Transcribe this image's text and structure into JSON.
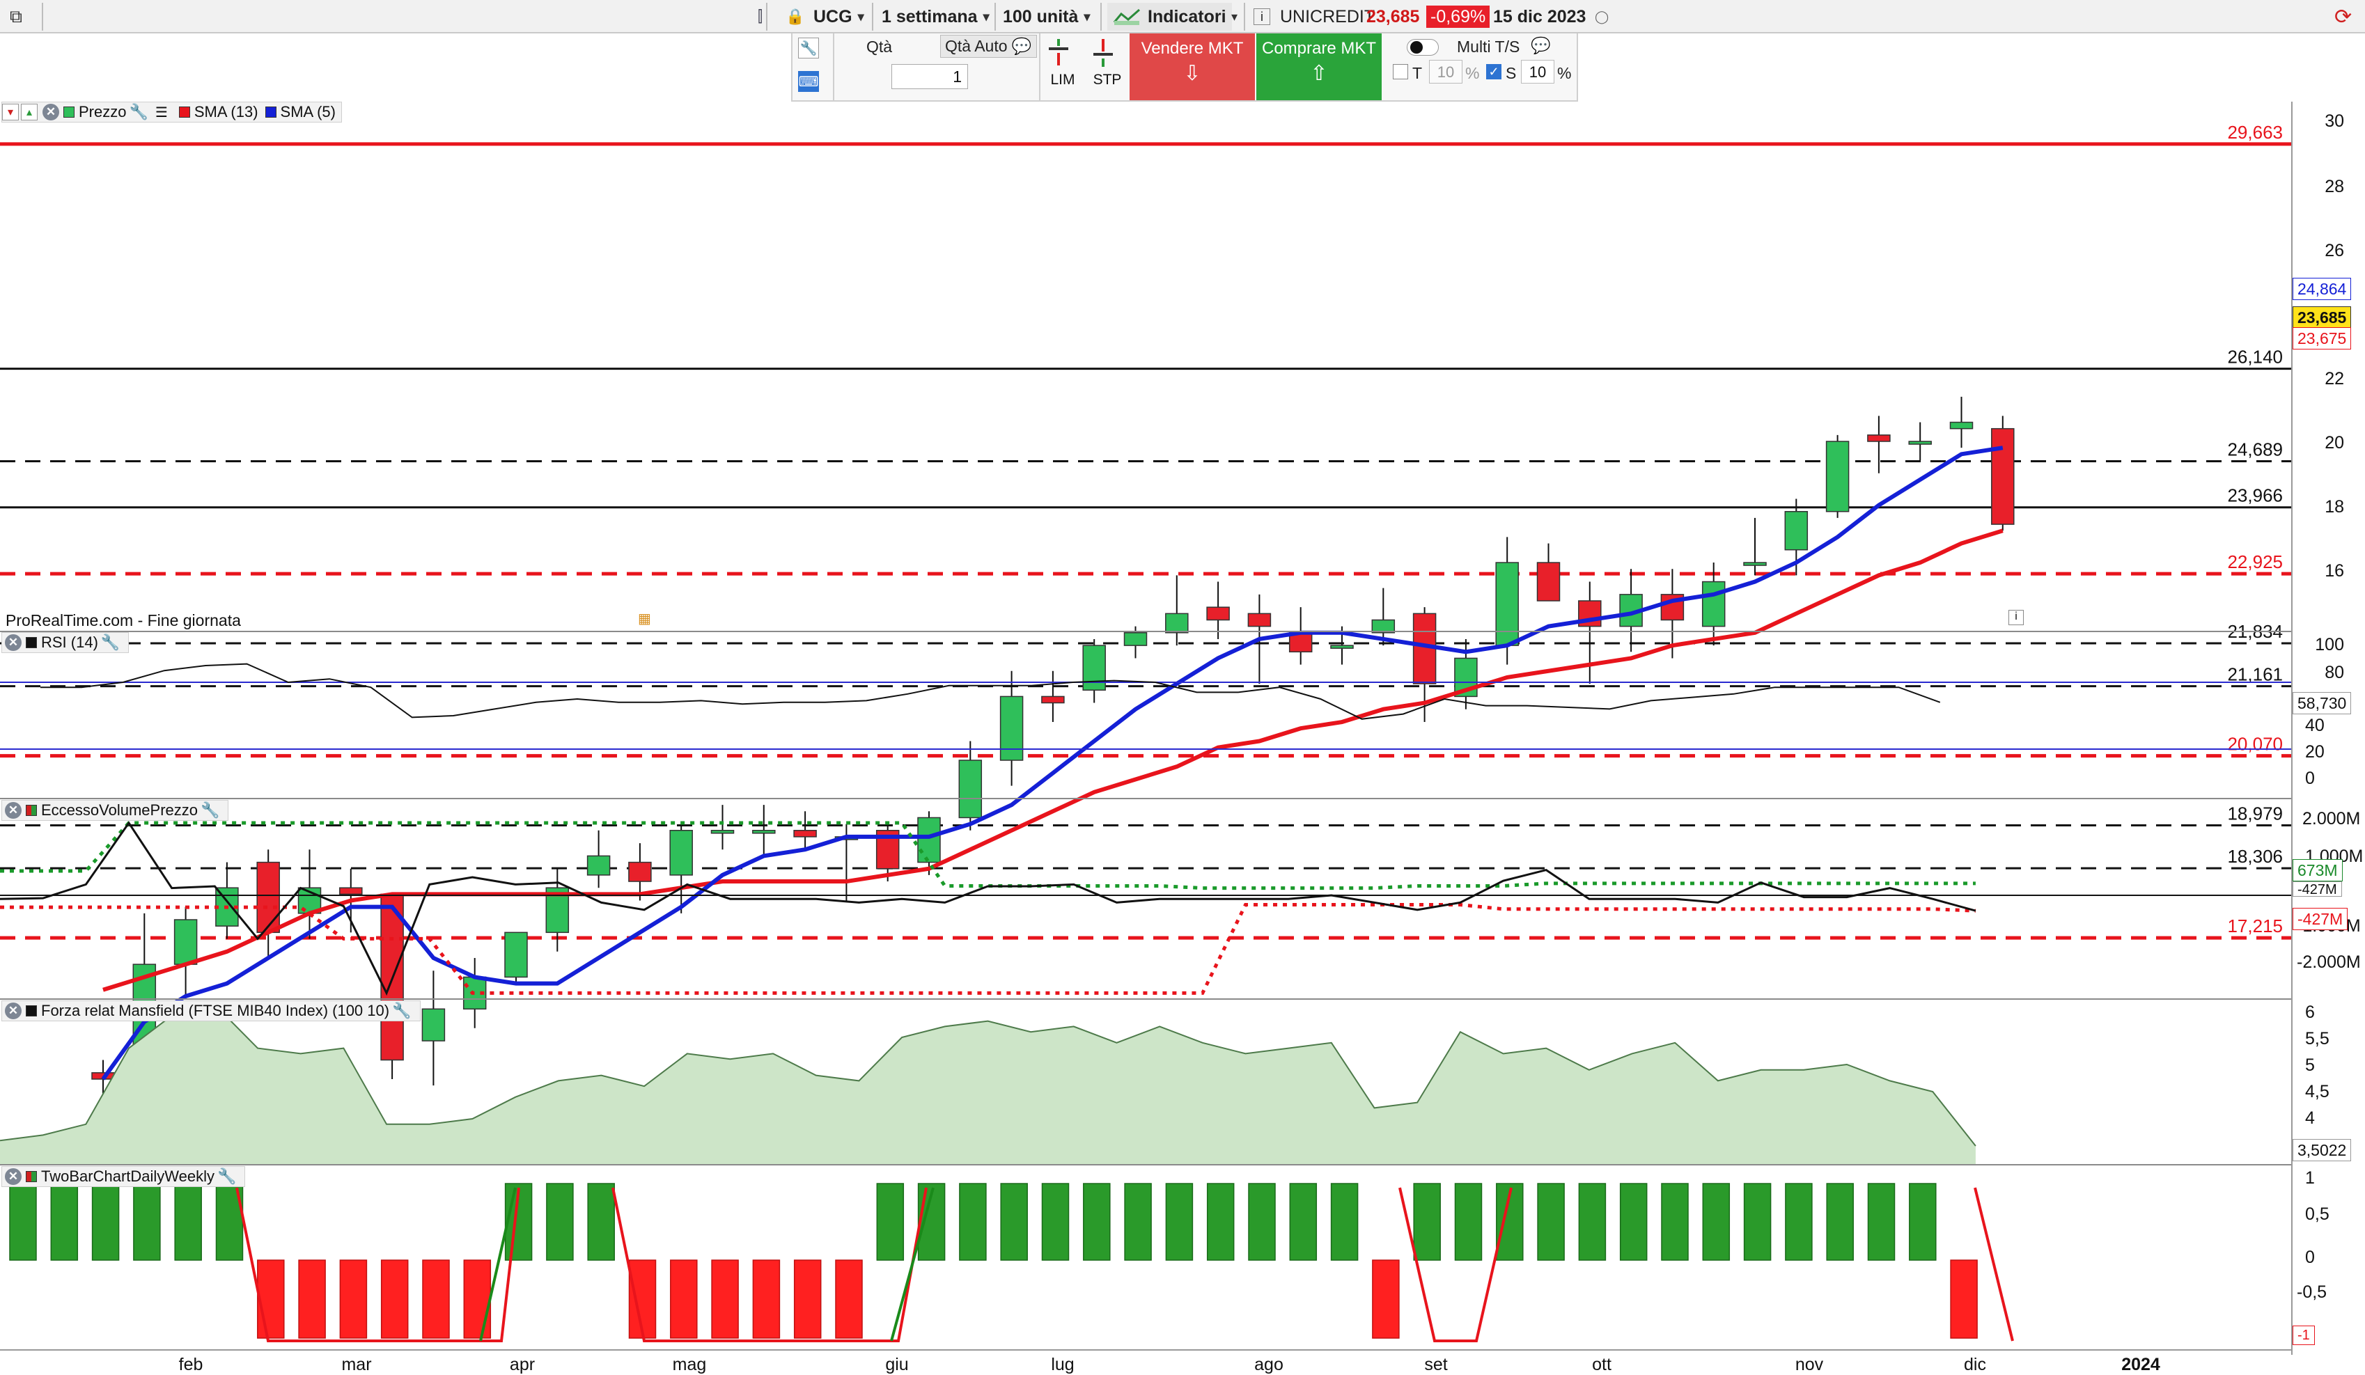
{
  "toolbar": {
    "symbol": "UCG",
    "timeframe": "1 settimana",
    "units": "100 unità",
    "indicators": "Indicatori",
    "instrument": "UNICREDIT",
    "price": "23,685",
    "change": "-0,69%",
    "date": "15 dic 2023"
  },
  "order": {
    "qty_label": "Qtà",
    "qty_auto": "Qtà Auto",
    "qty_value": "1",
    "lim": "LIM",
    "stp": "STP",
    "sell": "Vendere MKT",
    "buy": "Comprare MKT",
    "multi": "Multi T/S",
    "t_label": "T",
    "t_value": "10",
    "s_label": "S",
    "s_value": "10",
    "pct": "%"
  },
  "price_panel": {
    "title": "Prezzo",
    "sma13": "SMA (13)",
    "sma5": "SMA (5)",
    "footer": "ProRealTime.com - Fine giornata",
    "ticks": [
      "30",
      "28",
      "26",
      "24",
      "22",
      "20",
      "18",
      "16"
    ],
    "level_labels": [
      {
        "text": "29,663",
        "color": "red"
      },
      {
        "text": "26,140",
        "color": "black"
      },
      {
        "text": "24,689",
        "color": "black"
      },
      {
        "text": "23,966",
        "color": "black"
      },
      {
        "text": "22,925",
        "color": "red"
      },
      {
        "text": "21,834",
        "color": "black"
      },
      {
        "text": "21,161",
        "color": "black"
      },
      {
        "text": "20,070",
        "color": "red"
      },
      {
        "text": "18,979",
        "color": "black"
      },
      {
        "text": "18,306",
        "color": "black"
      },
      {
        "text": "17,215",
        "color": "red"
      }
    ],
    "tag_sma5": "24,864",
    "tag_price": "23,685",
    "tag_sma13": "23,675",
    "colors": {
      "up": "#2fbf5a",
      "down": "#e8202a",
      "sma13": "#e8141c",
      "sma5": "#1420d6"
    }
  },
  "rsi_panel": {
    "title": "RSI (14)",
    "ticks": [
      "100",
      "80",
      "60",
      "40",
      "20",
      "0"
    ],
    "tag": "58,730"
  },
  "evp_panel": {
    "title": "EccessoVolumePrezzo",
    "ticks": [
      "2.000M",
      "1.000M",
      "0",
      "-1.000M",
      "-2.000M"
    ],
    "tag_up": "673M",
    "tag_mid": "-427M",
    "tag_down": "-427M"
  },
  "mansfield_panel": {
    "title": "Forza relat Mansfield (FTSE MIB40 Index) (100 10)",
    "ticks": [
      "6",
      "5,5",
      "5",
      "4,5",
      "4"
    ],
    "tag": "3,5022"
  },
  "twobar_panel": {
    "title": "TwoBarChartDailyWeekly",
    "ticks": [
      "1",
      "0,5",
      "0",
      "-0,5"
    ],
    "tag": "-1"
  },
  "xaxis": [
    "feb",
    "mar",
    "apr",
    "mag",
    "giu",
    "lug",
    "ago",
    "set",
    "ott",
    "nov",
    "dic",
    "2024"
  ]
}
